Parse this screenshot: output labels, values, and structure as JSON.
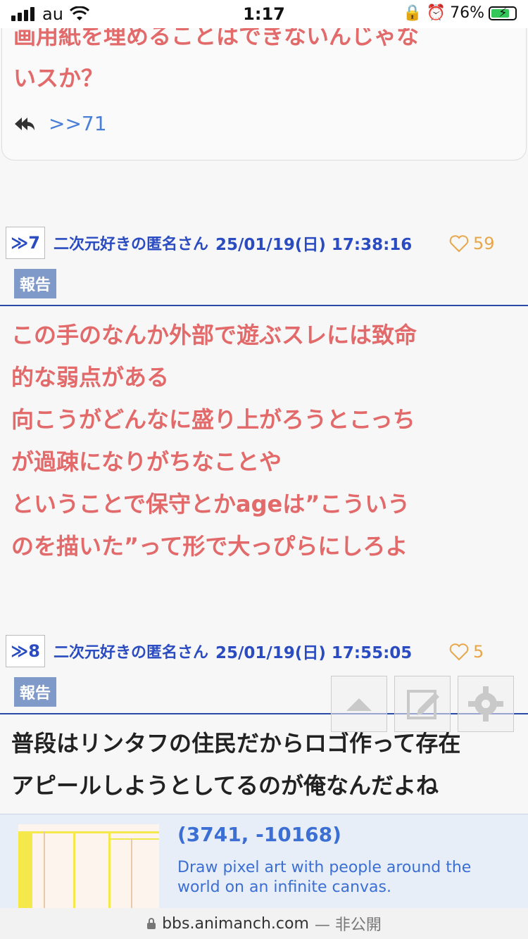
{
  "status_bar": {
    "carrier": "au",
    "time": "1:17",
    "battery": "76%"
  },
  "post6": {
    "text_lines": [
      "画用紙を埋めることはできないんじゃな",
      "いスか？"
    ],
    "reply_link": ">>71"
  },
  "post7": {
    "number": "≫7",
    "name": "二次元好きの匿名さん",
    "date": "25/01/19(日) 17:38:16",
    "likes": "59",
    "report": "報告",
    "text_lines": [
      "この手のなんか外部で遊ぶスレには致命",
      "的な弱点がある",
      "向こうがどんなに盛り上がろうとこっち",
      "が過疎になりがちなことや",
      "ということで保守とかageは”こういう",
      "のを描いた”って形で大っぴらにしろよ"
    ]
  },
  "post8": {
    "number": "≫8",
    "name": "二次元好きの匿名さん",
    "date": "25/01/19(日) 17:55:05",
    "likes": "5",
    "report": "報告",
    "text_lines": [
      "普段はリンタフの住民だからロゴ作って存在",
      "アピールしようとしてるのが俺なんだよね"
    ]
  },
  "ad": {
    "title": "(3741, -10168)",
    "description": "Draw pixel art with people around the world on an infinite canvas."
  },
  "url_bar": {
    "domain": "bbs.animanch.com",
    "privacy": "— 非公開"
  },
  "colors": {
    "link_blue": "#2b4cc0",
    "post_red": "#e26a6a",
    "report_badge": "#7f9ac8",
    "like_orange": "#e8a64a"
  }
}
